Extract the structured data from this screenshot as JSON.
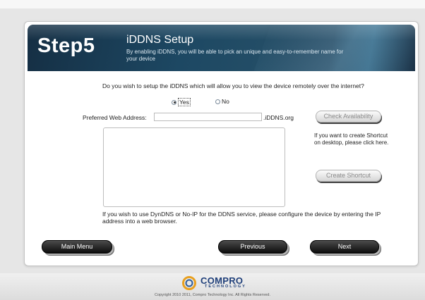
{
  "header": {
    "step": "Step5",
    "title": "iDDNS Setup",
    "subtitle": "By enabling iDDNS, you will be able to pick an unique and easy-to-remember name for your device"
  },
  "form": {
    "question": "Do you wish to setup the iDDNS which will allow you to view the device remotely over the internet?",
    "yes_label": "Yes",
    "no_label": "No",
    "selected": "Yes",
    "address_label": "Preferred Web Address:",
    "address_value": "",
    "address_suffix": ".iDDNS.org",
    "check_button": "Check Availability",
    "shortcut_text": "If you want to create Shortcut on desktop, please click here.",
    "shortcut_button": "Create Shortcut",
    "note": "If you wish to use DynDNS or No-IP for the DDNS service, please configure the device by entering the IP address into a web browser."
  },
  "nav": {
    "main_menu": "Main Menu",
    "previous": "Previous",
    "next": "Next"
  },
  "footer": {
    "brand": "COMPRO",
    "brand_sub": "TECHNOLOGY",
    "copyright": "Copyright 2010 2011, Compro Technology Inc. All Rights Reserved."
  }
}
